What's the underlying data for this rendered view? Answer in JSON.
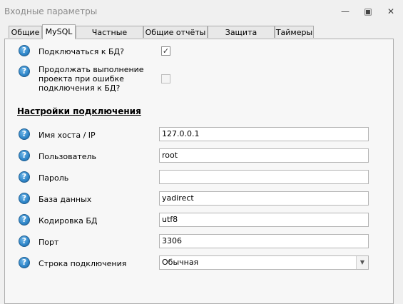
{
  "window": {
    "title": "Входные параметры",
    "minimize_icon": "—",
    "restore_icon": "▣",
    "close_icon": "✕"
  },
  "tabs": [
    {
      "label": "Общие"
    },
    {
      "label": "MySQL"
    },
    {
      "label": "Частные отчёты"
    },
    {
      "label": "Общие отчёты"
    },
    {
      "label": "Защита отчётов"
    },
    {
      "label": "Таймеры"
    }
  ],
  "active_tab": "MySQL",
  "help_glyph": "?",
  "options": {
    "connect_db": {
      "label": "Подключаться к БД?",
      "checked": true,
      "mark": "✓"
    },
    "continue_on_error": {
      "label": "Продолжать выполнение проекта при ошибке подключения к БД?",
      "checked": false,
      "mark": ""
    }
  },
  "section_title": "Настройки подключения",
  "fields": [
    {
      "label": "Имя хоста / IP",
      "value": "127.0.0.1"
    },
    {
      "label": "Пользователь",
      "value": "root"
    },
    {
      "label": "Пароль",
      "value": ""
    },
    {
      "label": "База данных",
      "value": "yadirect"
    },
    {
      "label": "Кодировка БД",
      "value": "utf8"
    },
    {
      "label": "Порт",
      "value": "3306"
    },
    {
      "label": "Строка подключения",
      "value": "Обычная"
    }
  ]
}
